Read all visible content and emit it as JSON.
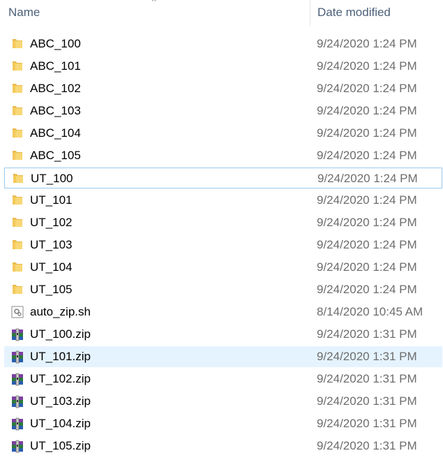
{
  "columns": {
    "name": "Name",
    "date_modified": "Date modified"
  },
  "files": [
    {
      "name": "ABC_100",
      "date": "9/24/2020 1:24 PM",
      "icon": "folder-icon"
    },
    {
      "name": "ABC_101",
      "date": "9/24/2020 1:24 PM",
      "icon": "folder-icon"
    },
    {
      "name": "ABC_102",
      "date": "9/24/2020 1:24 PM",
      "icon": "folder-icon"
    },
    {
      "name": "ABC_103",
      "date": "9/24/2020 1:24 PM",
      "icon": "folder-icon"
    },
    {
      "name": "ABC_104",
      "date": "9/24/2020 1:24 PM",
      "icon": "folder-icon"
    },
    {
      "name": "ABC_105",
      "date": "9/24/2020 1:24 PM",
      "icon": "folder-icon"
    },
    {
      "name": "UT_100",
      "date": "9/24/2020 1:24 PM",
      "icon": "folder-icon",
      "state": "focused"
    },
    {
      "name": "UT_101",
      "date": "9/24/2020 1:24 PM",
      "icon": "folder-icon"
    },
    {
      "name": "UT_102",
      "date": "9/24/2020 1:24 PM",
      "icon": "folder-icon"
    },
    {
      "name": "UT_103",
      "date": "9/24/2020 1:24 PM",
      "icon": "folder-icon"
    },
    {
      "name": "UT_104",
      "date": "9/24/2020 1:24 PM",
      "icon": "folder-icon"
    },
    {
      "name": "UT_105",
      "date": "9/24/2020 1:24 PM",
      "icon": "folder-icon"
    },
    {
      "name": "auto_zip.sh",
      "date": "8/14/2020 10:45 AM",
      "icon": "script-file-icon"
    },
    {
      "name": "UT_100.zip",
      "date": "9/24/2020 1:31 PM",
      "icon": "winrar-archive-icon"
    },
    {
      "name": "UT_101.zip",
      "date": "9/24/2020 1:31 PM",
      "icon": "winrar-archive-icon",
      "state": "hovered"
    },
    {
      "name": "UT_102.zip",
      "date": "9/24/2020 1:31 PM",
      "icon": "winrar-archive-icon"
    },
    {
      "name": "UT_103.zip",
      "date": "9/24/2020 1:31 PM",
      "icon": "winrar-archive-icon"
    },
    {
      "name": "UT_104.zip",
      "date": "9/24/2020 1:31 PM",
      "icon": "winrar-archive-icon"
    },
    {
      "name": "UT_105.zip",
      "date": "9/24/2020 1:31 PM",
      "icon": "winrar-archive-icon"
    }
  ],
  "colors": {
    "folder": "#f8d775",
    "header_text": "#4c607a",
    "hover_bg": "#e5f3ff",
    "focus_border": "#99c9ef"
  }
}
